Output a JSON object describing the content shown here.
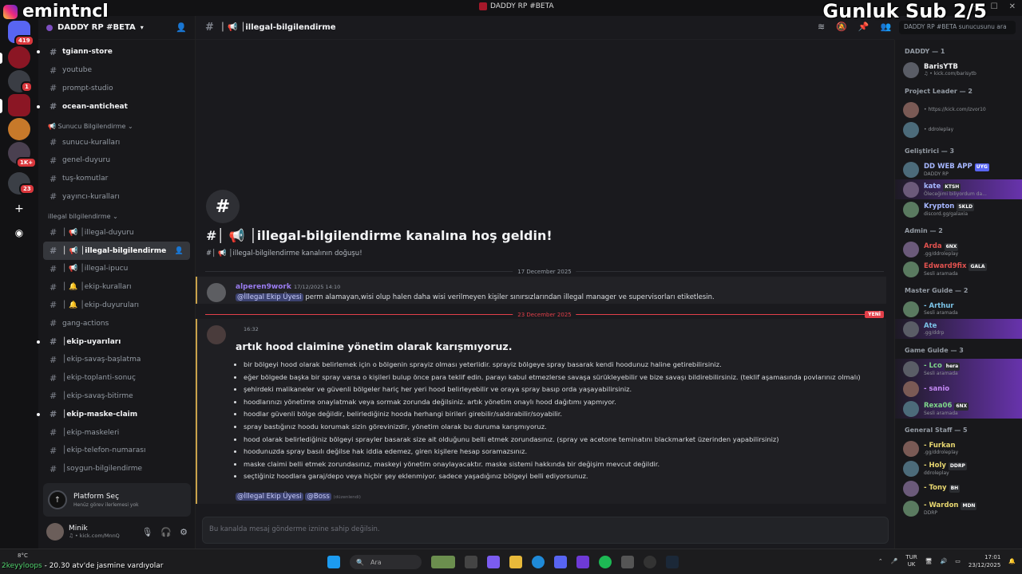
{
  "window": {
    "title": "DADDY RP #BETA"
  },
  "overlay": {
    "streamer": "emintncl",
    "sub_goal": "Gunluk Sub 2/5"
  },
  "rail": {
    "badges": [
      "419",
      "1",
      "1K+",
      "23"
    ]
  },
  "sidebar": {
    "server_name": "DADDY RP #BETA",
    "channels_top": [
      "tgiann-store",
      "youtube",
      "prompt-studio",
      "ocean-anticheat"
    ],
    "cat1": "Sunucu Bilgilendirme",
    "channels_cat1": [
      "sunucu-kuralları",
      "genel-duyuru",
      "tuş-komutlar",
      "yayıncı-kuralları"
    ],
    "cat2": "illegal bilgilendirme",
    "channels_cat2": [
      "│ 📢 │illegal-duyuru",
      "│ 📢 │illegal-bilgilendirme",
      "│ 📢 │illegal-ipucu",
      "│ 🔔 │ekip-kuralları",
      "│ 🔔 │ekip-duyuruları",
      "gang-actions",
      "│ekip-uyarıları",
      "│ekip-savaş-başlatma",
      "│ekip-toplanti-sonuç",
      "│ekip-savaş-bitirme",
      "│ekip-maske-claim",
      "│ekip-maskeleri",
      "│ekip-telefon-numarası",
      "│soygun-bilgilendirme"
    ],
    "platform_title": "Platform Seç",
    "platform_sub": "Henüz görev ilerlemesi yok",
    "user_name": "Minik",
    "user_status": "♫ • kick.com/MnnQ"
  },
  "main": {
    "channel_name": "│ 📢 │illegal-bilgilendirme",
    "search_placeholder": "DADDY RP #BETA sunucusunu ara",
    "welcome_icon": "#",
    "welcome_title": "#│ 📢 │illegal-bilgilendirme kanalına hoş geldin!",
    "welcome_sub": "#│ 📢 │illegal-bilgilendirme kanalının doğuşu!",
    "date1": "17 December 2025",
    "msg1": {
      "author": "alperen9work",
      "time": "17/12/2025 14:10",
      "mention": "@İllegal Ekip Üyesi",
      "text": " perm alamayan,wisi olup halen daha wisi verilmeyen kişiler sınırsızlarından illegal manager ve supervisorları etiketlesin."
    },
    "date2": "23 December 2025",
    "new_label": "YENİ",
    "msg2": {
      "time": "16:32",
      "heading": "artık hood claimine yönetim olarak karışmıyoruz.",
      "bullets": [
        "bir bölgeyi hood olarak belirlemek için o bölgenin sprayiz olması yeterlidir. sprayiz bölgeye spray basarak kendi hoodunuz haline getirebilirsiniz.",
        "eğer bölgede başka bir spray varsa o kişileri bulup önce para teklif edin. parayı kabul etmezlerse savaşa sürükleyebilir ve bize savaşı bildirebilirsiniz. (teklif aşamasında povlarınız olmalı)",
        "şehirdeki malikaneler ve güvenli bölgeler hariç her yeri hood belirleyebilir ve oraya spray basıp orda yaşayabilirsiniz.",
        "hoodlarınızı yönetime onaylatmak veya sormak zorunda değilsiniz. artık yönetim onaylı hood dağıtımı yapmıyor.",
        "hoodlar güvenli bölge değildir, belirlediğiniz hooda herhangi birileri girebilir/saldırabilir/soyabilir.",
        "spray bastığınız hoodu korumak sizin görevinizdir, yönetim olarak bu duruma karışmıyoruz.",
        "hood olarak belirlediğiniz bölgeyi sprayler basarak size ait olduğunu belli etmek zorundasınız. (spray ve acetone teminatını blackmarket üzerinden yapabilirsiniz)",
        "hoodunuzda spray basılı değilse hak iddia edemez, giren kişilere hesap soramazsınız.",
        "maske claimi belli etmek zorundasınız, maskeyi yönetim onaylayacaktır. maske sistemi hakkında bir değişim mevcut değildir.",
        "seçtiğiniz  hoodlara garaj/depo veya hiçbir şey eklenmiyor. sadece yaşadığınız bölgeyi belli ediyorsunuz."
      ],
      "mention1": "@İllegal Ekip Üyesi",
      "mention2": "@Boss",
      "edited": "(düzenlendi)"
    },
    "composer_placeholder": "Bu kanalda mesaj gönderme iznine sahip değilsin."
  },
  "members": {
    "groups": [
      {
        "title": "DADDY — 1",
        "list": [
          {
            "name": "BarisYTB",
            "tag": "",
            "status": "♫ • kick.com/barisytb",
            "color": "#f2f3f5",
            "hl": false
          }
        ]
      },
      {
        "title": "Project Leader — 2",
        "list": [
          {
            "name": "",
            "tag": "",
            "status": "• https://kick.com/izvor10",
            "color": "#f2f3f5",
            "hl": false
          },
          {
            "name": "",
            "tag": "",
            "status": "• ddroleplay",
            "color": "#f2f3f5",
            "hl": false
          }
        ]
      },
      {
        "title": "Geliştirici — 3",
        "list": [
          {
            "name": "DD WEB APP",
            "tag": "UYG",
            "status": "DADDY RP",
            "color": "#a6b7ff",
            "hl": false
          },
          {
            "name": "kate",
            "tag": "KTSH",
            "status": "Öleceğimi biliyordum da...",
            "color": "#a6b7ff",
            "hl": true
          },
          {
            "name": "Krypton",
            "tag": "SKLD",
            "status": "discord.gg/galaxia",
            "color": "#a6b7ff",
            "hl": false
          }
        ]
      },
      {
        "title": "Admin — 2",
        "list": [
          {
            "name": "Arda",
            "tag": "6NX",
            "status": ".gg/ddroleplay",
            "color": "#e2524f",
            "hl": false
          },
          {
            "name": "Edward9fix",
            "tag": "GALA",
            "status": "Sesli aramada",
            "color": "#e2524f",
            "hl": false
          }
        ]
      },
      {
        "title": "Master Guide — 2",
        "list": [
          {
            "name": "- Arthur",
            "tag": "",
            "status": "Sesli aramada",
            "color": "#7cc4e8",
            "hl": false
          },
          {
            "name": "Ate",
            "tag": "",
            "status": ".gg/ddrp",
            "color": "#7cc4e8",
            "hl": true
          }
        ]
      },
      {
        "title": "Game Guide — 3",
        "list": [
          {
            "name": "- Lco",
            "tag": "hera",
            "status": "Sesli aramada",
            "color": "#7ed68a",
            "hl": true
          },
          {
            "name": "- sanio",
            "tag": "",
            "status": "",
            "color": "#c58af5",
            "hl": true
          },
          {
            "name": "Rexa06",
            "tag": "6NX",
            "status": "Sesli aramada",
            "color": "#7ed68a",
            "hl": true
          }
        ]
      },
      {
        "title": "General Staff — 5",
        "list": [
          {
            "name": "- Furkan",
            "tag": "",
            "status": ".gg/ddroleplay",
            "color": "#e8d770",
            "hl": false
          },
          {
            "name": "- Holy",
            "tag": "DDRP",
            "status": "ddroleplay",
            "color": "#e8d770",
            "hl": false
          },
          {
            "name": "- Tony",
            "tag": "BH",
            "status": "",
            "color": "#e8d770",
            "hl": false
          },
          {
            "name": "- Wardon",
            "tag": "MDN",
            "status": "DDRP",
            "color": "#e8d770",
            "hl": false
          }
        ]
      }
    ]
  },
  "taskbar": {
    "weather": "8°C",
    "ticker_user": "2keyyloops",
    "ticker_text": " - 20.30 atv'de jasmine vardıyolar",
    "search": "Ara",
    "lang1": "TUR",
    "lang2": "UK",
    "time": "17:01",
    "date": "23/12/2025"
  }
}
